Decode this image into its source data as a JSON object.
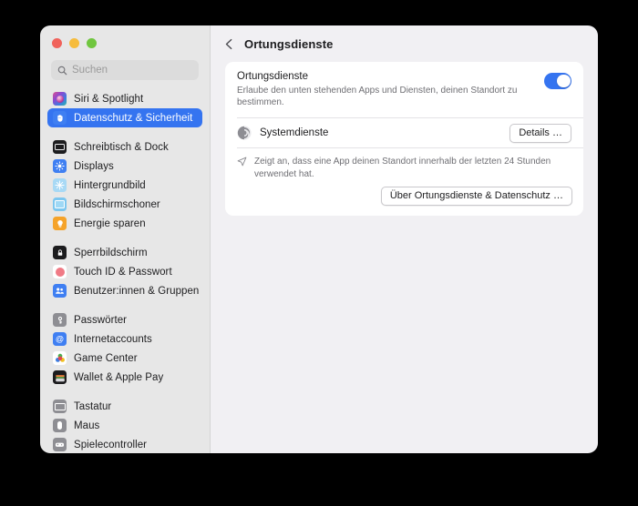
{
  "window": {
    "traffic_lights": [
      {
        "name": "close",
        "color": "#f0625b"
      },
      {
        "name": "minimize",
        "color": "#f6bc3c"
      },
      {
        "name": "maximize",
        "color": "#70c63f"
      }
    ]
  },
  "sidebar": {
    "search": {
      "placeholder": "Suchen",
      "value": "",
      "icon": "search-icon"
    },
    "groups": [
      {
        "items": [
          {
            "label": "Siri & Spotlight",
            "icon": "siri-icon",
            "selected": false
          },
          {
            "label": "Datenschutz & Sicherheit",
            "icon": "hand-privacy-icon",
            "selected": true
          }
        ]
      },
      {
        "items": [
          {
            "label": "Schreibtisch & Dock",
            "icon": "dock-icon",
            "selected": false
          },
          {
            "label": "Displays",
            "icon": "display-icon",
            "selected": false
          },
          {
            "label": "Hintergrundbild",
            "icon": "wallpaper-icon",
            "selected": false
          },
          {
            "label": "Bildschirmschoner",
            "icon": "screensaver-icon",
            "selected": false
          },
          {
            "label": "Energie sparen",
            "icon": "energy-icon",
            "selected": false
          }
        ]
      },
      {
        "items": [
          {
            "label": "Sperrbildschirm",
            "icon": "lockscreen-icon",
            "selected": false
          },
          {
            "label": "Touch ID & Passwort",
            "icon": "touchid-icon",
            "selected": false
          },
          {
            "label": "Benutzer:innen & Gruppen",
            "icon": "users-groups-icon",
            "selected": false
          }
        ]
      },
      {
        "items": [
          {
            "label": "Passwörter",
            "icon": "key-icon",
            "selected": false
          },
          {
            "label": "Internetaccounts",
            "icon": "at-sign-icon",
            "selected": false
          },
          {
            "label": "Game Center",
            "icon": "game-center-icon",
            "selected": false
          },
          {
            "label": "Wallet & Apple Pay",
            "icon": "wallet-icon",
            "selected": false
          }
        ]
      },
      {
        "items": [
          {
            "label": "Tastatur",
            "icon": "keyboard-icon",
            "selected": false
          },
          {
            "label": "Maus",
            "icon": "mouse-icon",
            "selected": false
          },
          {
            "label": "Spielecontroller",
            "icon": "game-controller-icon",
            "selected": false
          }
        ]
      }
    ]
  },
  "main": {
    "back_label": "",
    "title": "Ortungsdienste",
    "location_services": {
      "title": "Ortungsdienste",
      "description": "Erlaube den unten stehenden Apps und Diensten, deinen Standort zu bestimmen.",
      "enabled": true
    },
    "system_services": {
      "label": "Systemdienste",
      "details_button": "Details …",
      "icon": "system-services-icon"
    },
    "footnote": {
      "text": "Zeigt an, dass eine App deinen Standort innerhalb der letzten 24 Stunden verwendet hat.",
      "icon": "location-arrow-icon"
    },
    "about_button": "Über Ortungsdienste & Datenschutz …"
  },
  "colors": {
    "accent": "#3574f0",
    "sidebar_bg": "#e7e7e7",
    "main_bg": "#f1f0f3",
    "card_bg": "#ffffff"
  }
}
